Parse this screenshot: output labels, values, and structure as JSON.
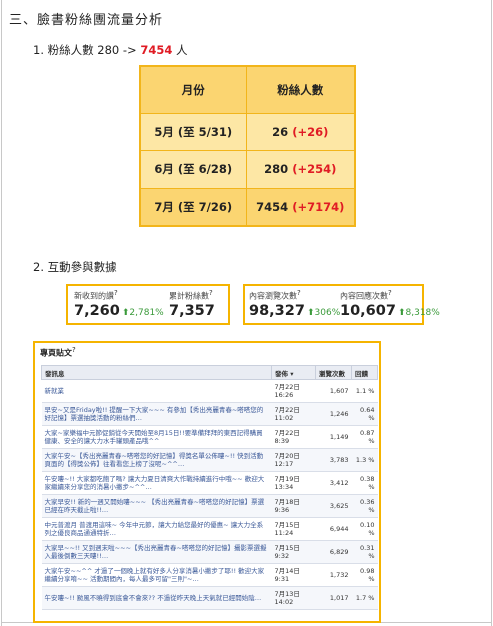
{
  "section_title": "三、臉書粉絲團流量分析",
  "fans": {
    "label": "1.  粉絲人數  280 ->",
    "value": "7454",
    "unit": "人"
  },
  "stats_table": {
    "headers": [
      "月份",
      "粉絲人數"
    ],
    "rows": [
      {
        "month": "5月 (至 5/31)",
        "count": "26",
        "delta": "(+26)"
      },
      {
        "month": "6月 (至 6/28)",
        "count": "280",
        "delta": "(+254)"
      },
      {
        "month": "7月 (至 7/26)",
        "count": "7454",
        "delta": "(+7174)"
      }
    ]
  },
  "engagement_title": "2.  互動參與數據",
  "cards": {
    "left": {
      "m1": {
        "label": "新收到的讚",
        "q": "?",
        "value": "7,260",
        "change": "2,781%"
      },
      "m2": {
        "label": "累計粉絲數",
        "q": "?",
        "value": "7,357"
      }
    },
    "right": {
      "m1": {
        "label": "內容瀏覽次數",
        "q": "?",
        "value": "98,327",
        "change": "306%"
      },
      "m2": {
        "label": "內容回應次數",
        "q": "?",
        "value": "10,607",
        "change": "8,318%"
      }
    }
  },
  "posts": {
    "title": "專頁貼文",
    "q": "?",
    "columns": [
      "發訊息",
      "發佈 ▾",
      "瀏覽次數",
      "回饋"
    ],
    "rows": [
      {
        "msg": "新就業",
        "date": "7月22日 16:26",
        "views": "1,607",
        "fb": "1.1 %"
      },
      {
        "msg": "早安~又是Friday啦!! 提醒一下大家~~~ 有參加【秀出亮麗青春~嗒嗒您的好記憶】票選抽獎活動的粉絲們…",
        "date": "7月22日 11:02",
        "views": "1,246",
        "fb": "0.64 %"
      },
      {
        "msg": "大家~家樂福中元節促銷從今天開始至8月15日!!要準備拜拜的東西記得購買健康、安全的讓大力水手罐頭產品哦^^",
        "date": "7月22日 8:39",
        "views": "1,149",
        "fb": "0.87 %"
      },
      {
        "msg": "大家午安~【秀出亮麗青春~嗒嗒您的好記憶】得獎名單公佈嘍~!! 快到活動頁面的【得獎公佈】往看看您上榜了沒呢~^^…",
        "date": "7月20日 12:17",
        "views": "3,783",
        "fb": "1.3 %"
      },
      {
        "msg": "午安嘍~!! 大家都吃飽了嗎? 讓大力夏日清爽大作戰持續進行中哦~~ 歡迎大家繼續來分享您的消暑小撇步~^^…",
        "date": "7月19日 13:34",
        "views": "3,412",
        "fb": "0.38 %"
      },
      {
        "msg": "大家早安!! 新的一週又開始嘍~~~ 【秀出亮麗青春~嗒嗒您的好記憶】票選已經在昨天截止啦!!…",
        "date": "7月18日 9:36",
        "views": "3,625",
        "fb": "0.36 %"
      },
      {
        "msg": "中元普渡月  普渡用這味~ 今年中元節，讓大力給您最好的優惠~ 讓大力全系列之優良商品通通特折…",
        "date": "7月15日 11:24",
        "views": "6,944",
        "fb": "0.10 %"
      },
      {
        "msg": "大家早~~!! 又到週末啦~~~【秀出亮麗青春~嗒嗒您的好記憶】攝影票選擬入最後倒數三天嘍!!…",
        "date": "7月15日 9:32",
        "views": "6,829",
        "fb": "0.31 %"
      },
      {
        "msg": "大家午安~~^^ 才過了一個晚上就有好多人分享消暑小撇步了耶!! 歡迎大家繼續分享唷~~ 活動期間內，每人最多可留\"三則\"~…",
        "date": "7月14日 9:31",
        "views": "1,732",
        "fb": "0.98 %"
      },
      {
        "msg": "午安嘍~!! 颱風不曉得到底會不會來?? 不過從昨天晚上天氣就已經開始陰…",
        "date": "7月13日 14:02",
        "views": "1,017",
        "fb": "1.7 %"
      }
    ]
  }
}
